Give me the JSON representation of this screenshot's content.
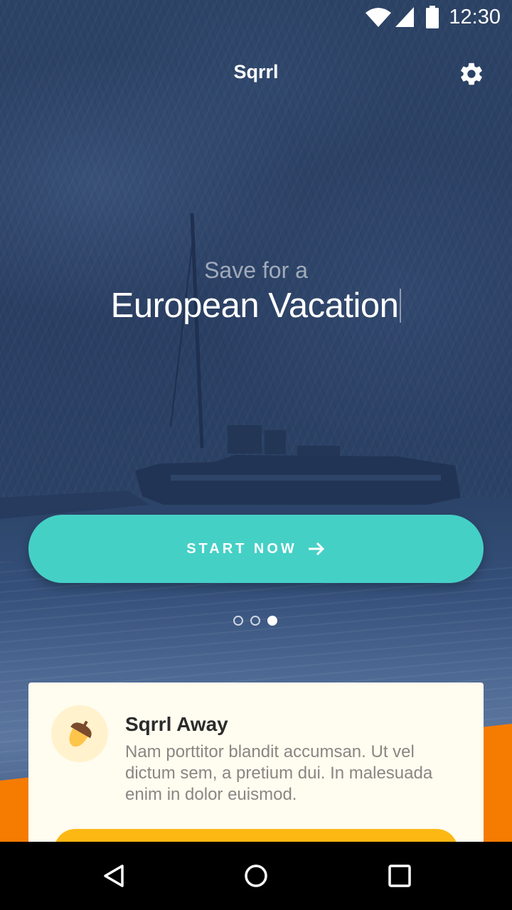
{
  "status_bar": {
    "time": "12:30",
    "icons": [
      "wifi-icon",
      "cell-signal-icon",
      "battery-icon"
    ]
  },
  "app_bar": {
    "title": "Sqrrl",
    "settings_icon": "gear-icon"
  },
  "hero": {
    "subtitle": "Save for a",
    "title": "European Vacation"
  },
  "cta": {
    "label": "START NOW",
    "icon": "arrow-right-icon",
    "color": "#45d0c6"
  },
  "pager": {
    "count": 3,
    "active_index": 2
  },
  "card": {
    "icon": "acorn-icon",
    "title": "Sqrrl Away",
    "body": "Nam porttitor blandit accumsan. Ut vel dictum sem, a pretium dui. In malesuada enim in dolor euismod.",
    "button_color": "#fdb813"
  },
  "nav_bar": {
    "icons": [
      "back-icon",
      "home-icon",
      "recents-icon"
    ]
  },
  "colors": {
    "accent": "#45d0c6",
    "orange": "#f57c00",
    "yellow": "#fdb813",
    "card_bg": "#fffcf0"
  }
}
